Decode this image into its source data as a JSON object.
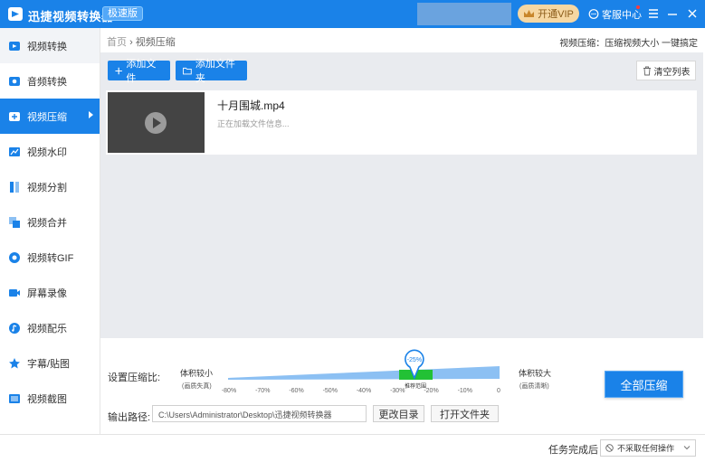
{
  "app": {
    "title": "迅捷视频转换器",
    "edition": "极速版",
    "vip_label": "开通VIP",
    "service_label": "客服中心"
  },
  "colors": {
    "primary": "#1a82e8",
    "accent_green": "#22c135",
    "slider_fill": "#8cc0f3",
    "vip_bg": "#f6d7a2"
  },
  "sidebar": {
    "items": [
      {
        "label": "视频转换",
        "icon": "video-convert-icon"
      },
      {
        "label": "音频转换",
        "icon": "audio-convert-icon"
      },
      {
        "label": "视频压缩",
        "icon": "video-compress-icon"
      },
      {
        "label": "视频水印",
        "icon": "video-watermark-icon"
      },
      {
        "label": "视频分割",
        "icon": "video-split-icon"
      },
      {
        "label": "视频合并",
        "icon": "video-merge-icon"
      },
      {
        "label": "视频转GIF",
        "icon": "video-gif-icon"
      },
      {
        "label": "屏幕录像",
        "icon": "screen-record-icon"
      },
      {
        "label": "视频配乐",
        "icon": "video-music-icon"
      },
      {
        "label": "字幕/贴图",
        "icon": "subtitle-sticker-icon"
      },
      {
        "label": "视频截图",
        "icon": "video-screenshot-icon"
      }
    ],
    "active_index": 2
  },
  "breadcrumb": {
    "home": "首页",
    "separator": "›",
    "current": "视频压缩"
  },
  "tip": "视频压缩：压缩视频大小 一键搞定",
  "toolbar": {
    "add_file": "添加文件",
    "add_folder": "添加文件夹",
    "clear_list": "清空列表"
  },
  "file": {
    "name": "十月围城.mp4",
    "status": "正在加载文件信息..."
  },
  "compression": {
    "label": "设置压缩比:",
    "left_label": "体积较小",
    "left_sub": "(画质失真)",
    "right_label": "体积较大",
    "right_sub": "(画质清晰)",
    "value_label": "-25%",
    "value": -25,
    "recommend_label": "推荐范围",
    "ticks": [
      "-80%",
      "-70%",
      "-60%",
      "-50%",
      "-40%",
      "-30%",
      "-20%",
      "-10%",
      "0"
    ]
  },
  "output": {
    "label": "输出路径:",
    "path": "C:\\Users\\Administrator\\Desktop\\迅捷视频转换器",
    "change_dir": "更改目录",
    "open_folder": "打开文件夹"
  },
  "compress_all": "全部压缩",
  "status": {
    "after_label": "任务完成后",
    "after_value": "不采取任何操作"
  }
}
